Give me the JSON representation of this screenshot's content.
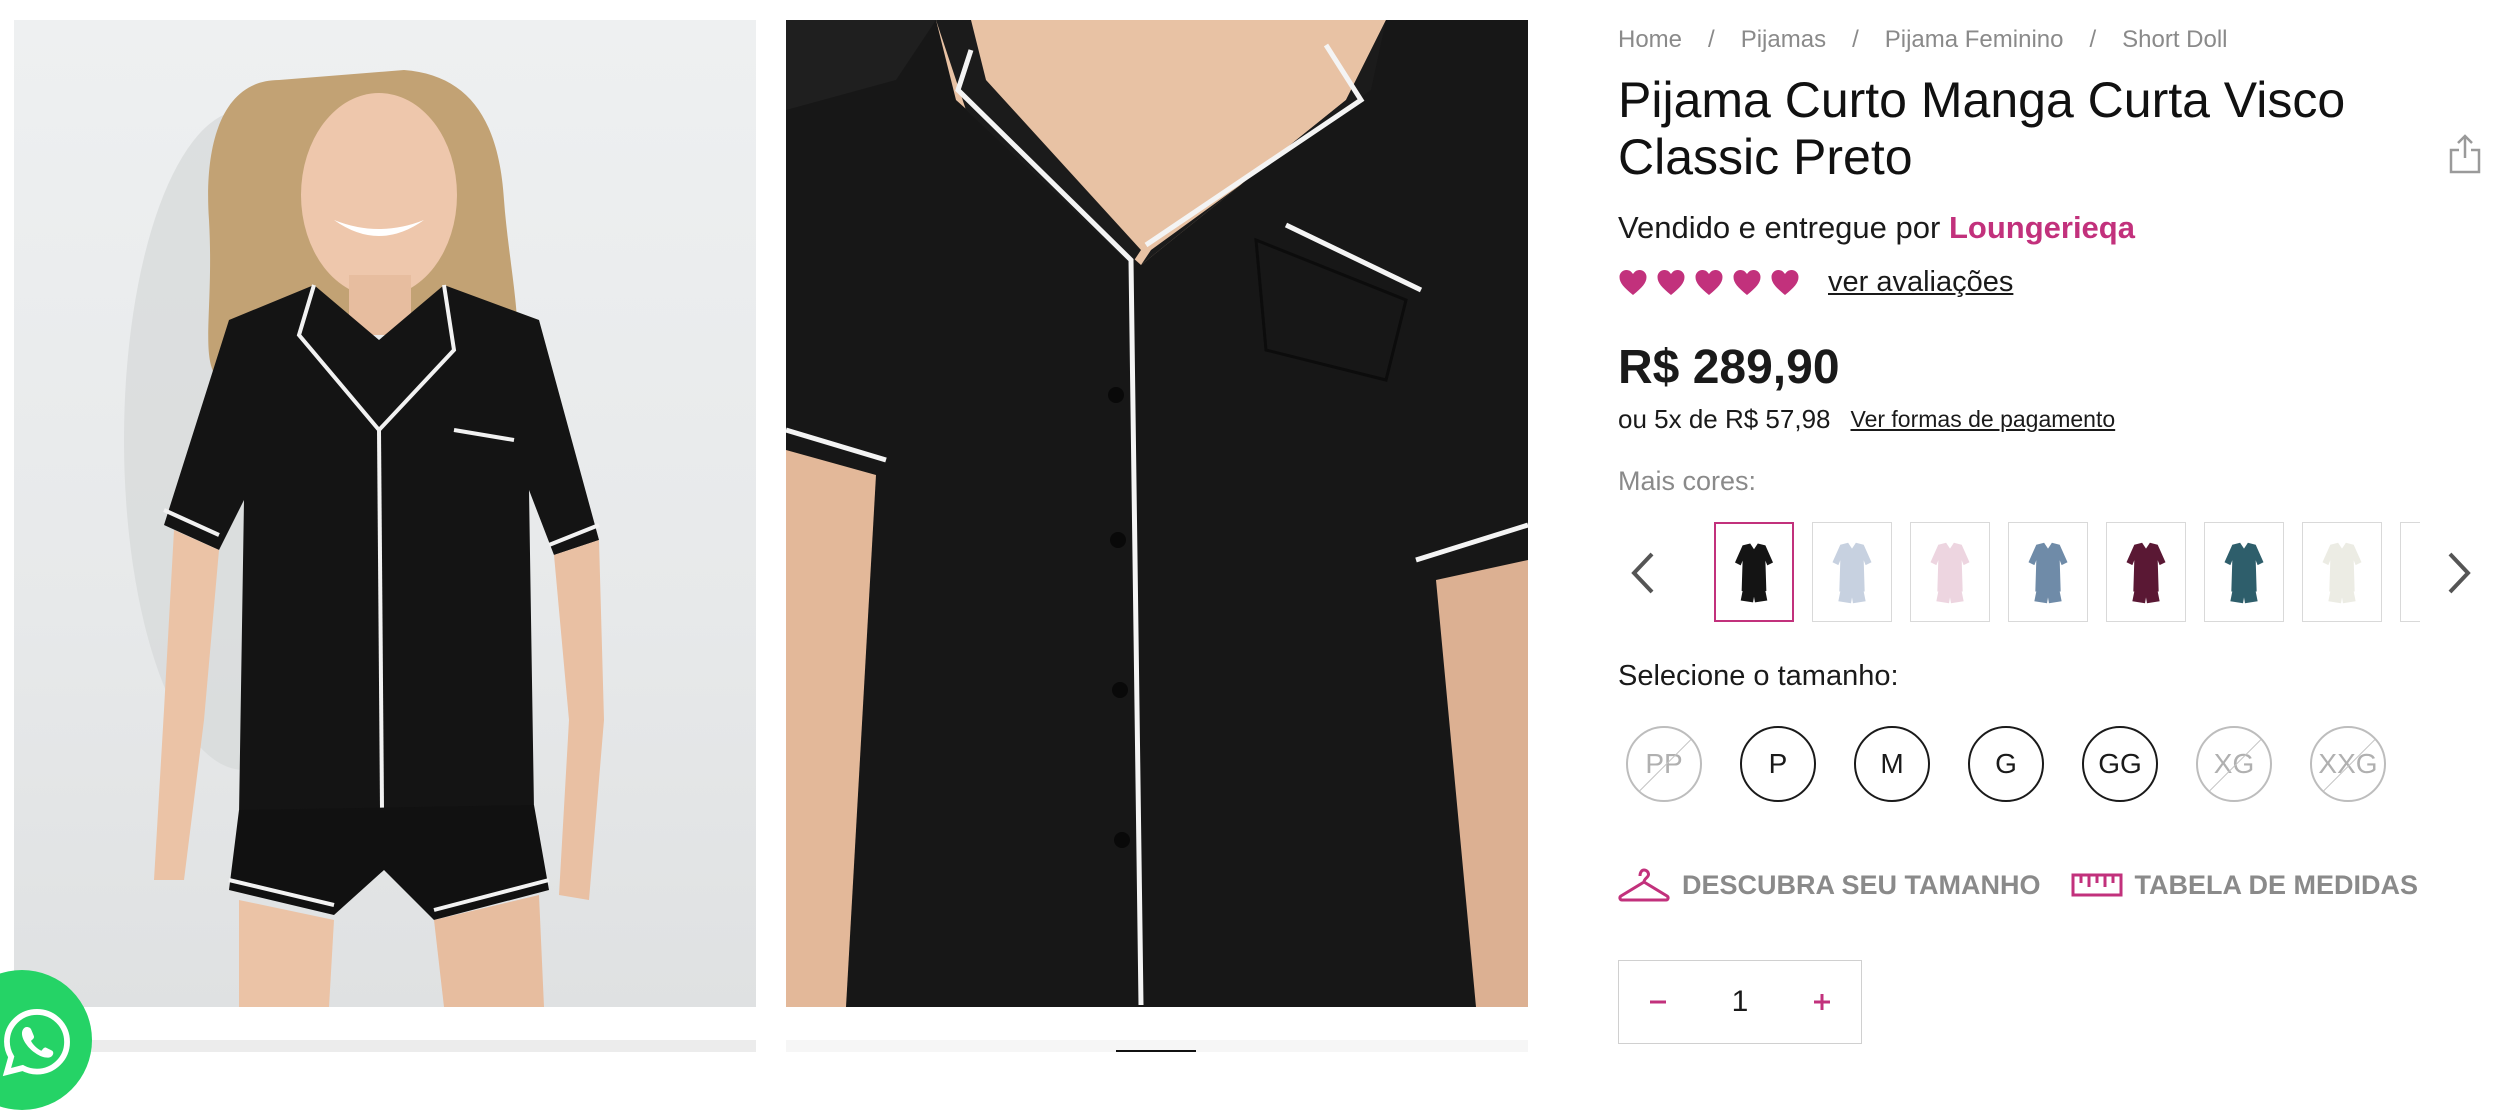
{
  "breadcrumb": [
    "Home",
    "Pijamas",
    "Pijama Feminino",
    "Short Doll"
  ],
  "breadcrumb_separator": "/",
  "product": {
    "title": "Pijama Curto Manga Curta Visco Classic Preto",
    "seller_prefix": "Vendido e entregue por",
    "seller_name": "Loungerieqa",
    "rating_hearts": 5,
    "reviews_link": "ver avaliações",
    "price": "R$ 289,90",
    "installments": "ou 5x de R$ 57,98",
    "payment_link": "Ver formas de pagamento"
  },
  "colors": {
    "label": "Mais cores:",
    "swatches": [
      {
        "color": "#141414",
        "selected": true
      },
      {
        "color": "#c7d1e0",
        "selected": false
      },
      {
        "color": "#edd5e0",
        "selected": false
      },
      {
        "color": "#6f8ba8",
        "selected": false
      },
      {
        "color": "#5a1834",
        "selected": false
      },
      {
        "color": "#2e5e6b",
        "selected": false
      },
      {
        "color": "#ecece4",
        "selected": false
      },
      {
        "color": "#c39a7c",
        "selected": false
      }
    ]
  },
  "sizes": {
    "label": "Selecione o tamanho:",
    "options": [
      {
        "label": "PP",
        "available": false
      },
      {
        "label": "P",
        "available": true
      },
      {
        "label": "M",
        "available": true
      },
      {
        "label": "G",
        "available": true
      },
      {
        "label": "GG",
        "available": true
      },
      {
        "label": "XG",
        "available": false
      },
      {
        "label": "XXG",
        "available": false
      }
    ]
  },
  "helpers": {
    "find_size": "DESCUBRA SEU TAMANHO",
    "size_chart": "TABELA DE MEDIDAS"
  },
  "quantity": {
    "value": "1",
    "minus": "−",
    "plus": "+"
  },
  "theme": {
    "accent": "#c2317c",
    "muted": "#8a8a8a"
  },
  "icons": [
    "share-icon",
    "heart-icon",
    "chevron-left-icon",
    "chevron-right-icon",
    "hanger-icon",
    "ruler-icon",
    "whatsapp-icon"
  ]
}
